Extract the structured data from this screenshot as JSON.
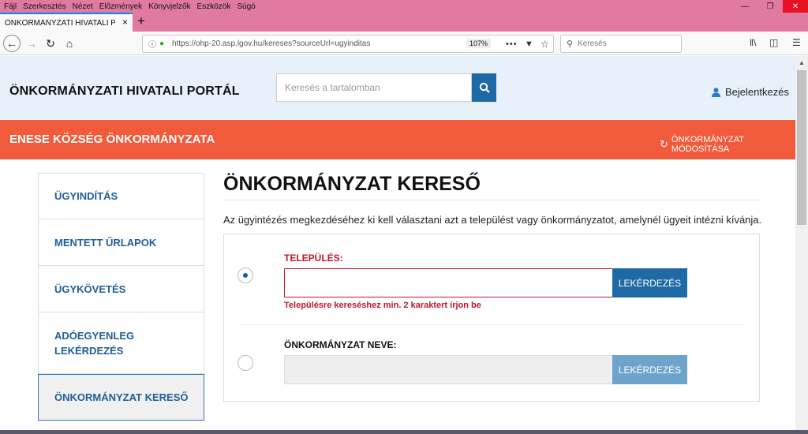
{
  "browser": {
    "menu": [
      "Fájl",
      "Szerkesztés",
      "Nézet",
      "Előzmények",
      "Könyvjelzők",
      "Eszközök",
      "Súgó"
    ],
    "tab_title": "ÖNKORMÁNYZATI HIVATALI PORT",
    "url": "https://ohp-20.asp.lgov.hu/kereses?sourceUrl=ugyinditas",
    "zoom": "107%",
    "search_placeholder": "Keresés"
  },
  "header": {
    "title": "ÖNKORMÁNYZATI HIVATALI PORTÁL",
    "search_placeholder": "Keresés a tartalomban",
    "login_label": "Bejelentkezés"
  },
  "band": {
    "title": "ENESE KÖZSÉG ÖNKORMÁNYZATA",
    "change_label": "ÖNKORMÁNYZAT MÓDOSÍTÁSA"
  },
  "sidebar": {
    "items": [
      {
        "label": "ÜGYINDÍTÁS"
      },
      {
        "label": "MENTETT ŰRLAPOK"
      },
      {
        "label": "ÜGYKÖVETÉS"
      },
      {
        "label": "ADÓEGYENLEG LEKÉRDEZÉS"
      },
      {
        "label": "ÖNKORMÁNYZAT KERESŐ"
      }
    ],
    "active_index": 4
  },
  "main": {
    "heading": "ÖNKORMÁNYZAT KERESŐ",
    "intro": "Az ügyintézés megkezdéséhez ki kell választani azt a települést vagy önkormányzatot, amelynél ügyeit intézni kívánja.",
    "option1": {
      "label": "TELEPÜLÉS:",
      "value": "",
      "button": "LEKÉRDEZÉS",
      "error": "Településre kereséshez min. 2 karaktert írjon be",
      "selected": true
    },
    "option2": {
      "label": "ÖNKORMÁNYZAT NEVE:",
      "value": "",
      "button": "LEKÉRDEZÉS",
      "selected": false
    }
  },
  "colors": {
    "accent_blue": "#1f6aa5",
    "band_orange": "#f15a3a",
    "error_red": "#c0172e",
    "menubar_pink": "#e07aa0"
  }
}
